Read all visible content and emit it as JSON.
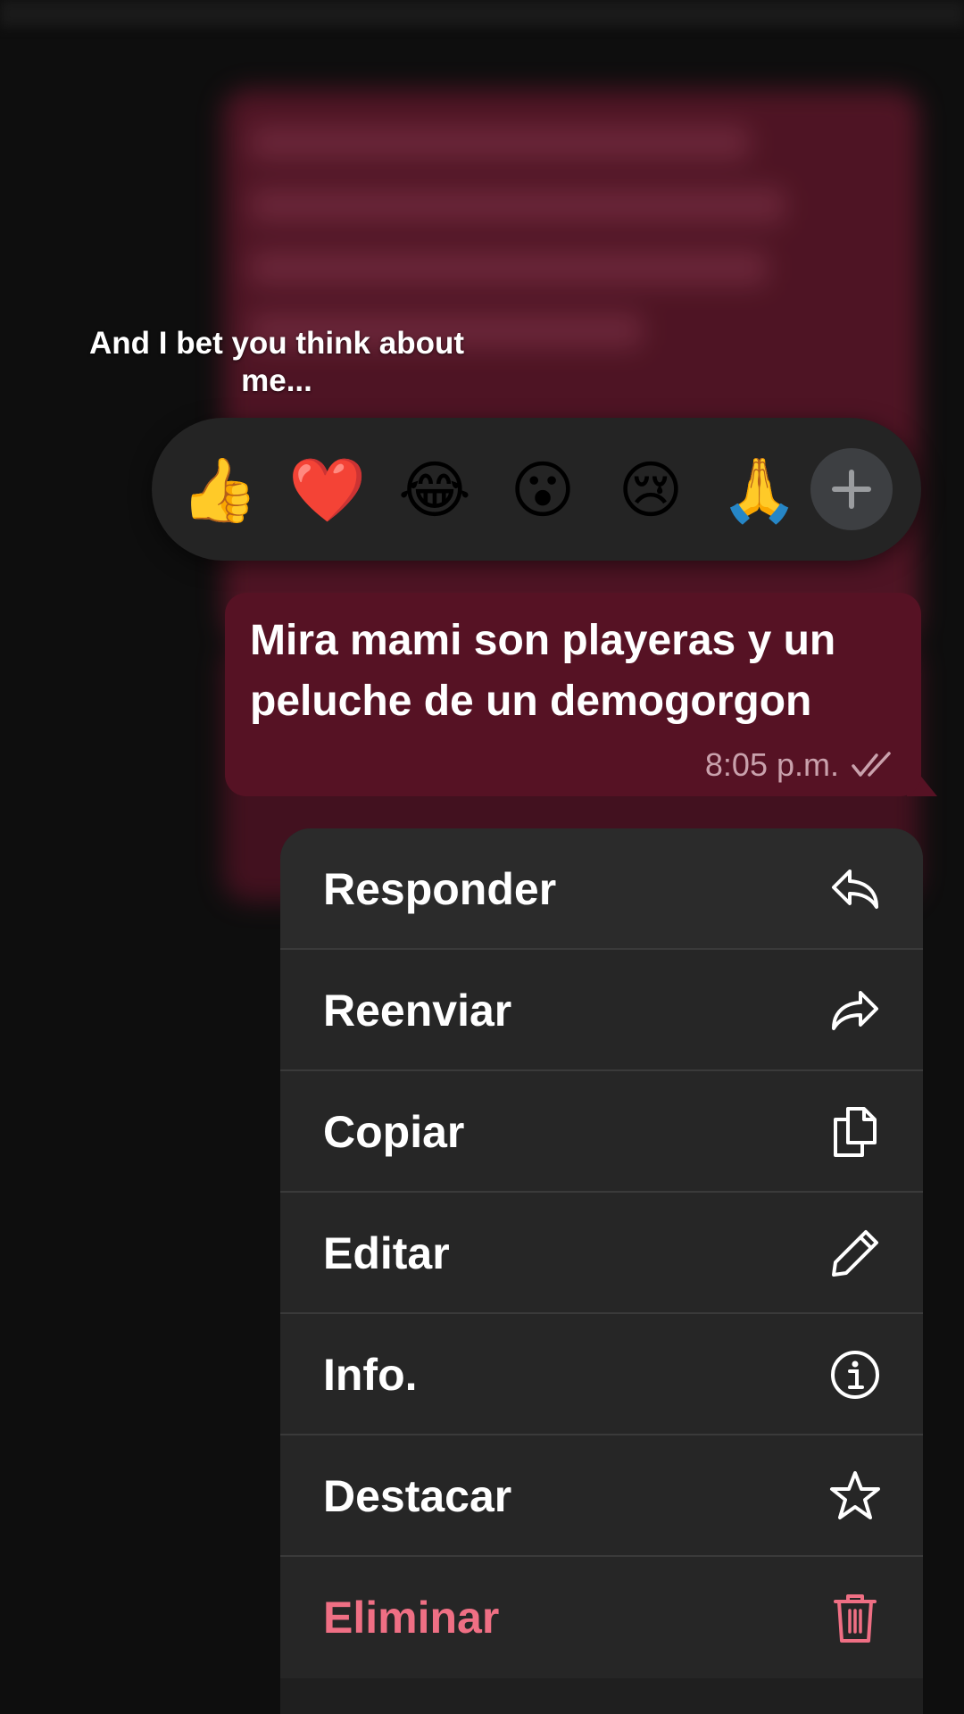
{
  "caption": "And I bet you think about me...",
  "reactions": {
    "items": [
      {
        "name": "thumbs-up",
        "glyph": "👍"
      },
      {
        "name": "heart",
        "glyph": "❤️"
      },
      {
        "name": "laughing",
        "glyph": "😂"
      },
      {
        "name": "surprised",
        "glyph": "😮"
      },
      {
        "name": "crying",
        "glyph": "😢"
      },
      {
        "name": "pray",
        "glyph": "🙏"
      }
    ],
    "more_icon": "plus-icon"
  },
  "message": {
    "text": "Mira mami son playeras y un peluche de un demogorgon",
    "time": "8:05 p.m.",
    "status_icon": "double-check-icon",
    "bubble_color": "#561224"
  },
  "menu": {
    "items": [
      {
        "label": "Responder",
        "icon": "reply-icon"
      },
      {
        "label": "Reenviar",
        "icon": "forward-icon"
      },
      {
        "label": "Copiar",
        "icon": "copy-icon"
      },
      {
        "label": "Editar",
        "icon": "pencil-icon"
      },
      {
        "label": "Info.",
        "icon": "info-icon"
      },
      {
        "label": "Destacar",
        "icon": "star-icon"
      },
      {
        "label": "Eliminar",
        "icon": "trash-icon",
        "danger": true,
        "color": "#ef6f84"
      }
    ]
  }
}
